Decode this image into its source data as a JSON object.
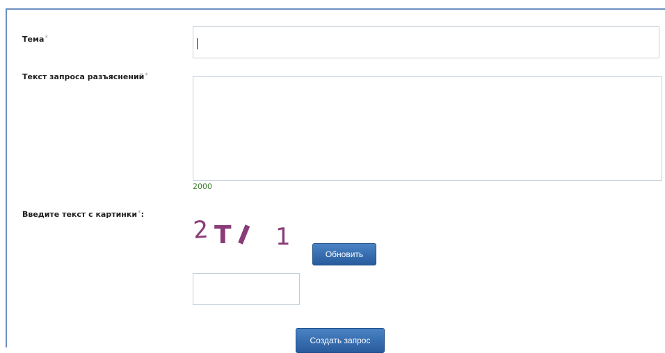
{
  "form": {
    "subject": {
      "label": "Тема",
      "required_mark": "*",
      "value": ""
    },
    "request_text": {
      "label": "Текст запроса разъяснений",
      "required_mark": "*",
      "value": "",
      "counter": "2000"
    },
    "captcha": {
      "label": "Введите текст с картинки",
      "required_mark": "*",
      "label_suffix": ":",
      "image_text": "2TI1",
      "refresh_button": "Обновить",
      "value": ""
    },
    "submit_button": "Создать запрос"
  },
  "colors": {
    "frame_border": "#6c8ec0",
    "button_gradient_top": "#4a83c5",
    "button_gradient_bottom": "#275b9c",
    "counter": "#3a7a2a",
    "captcha_ink": "#8a3c78"
  },
  "icons": {
    "required_marker": "asterisk"
  }
}
